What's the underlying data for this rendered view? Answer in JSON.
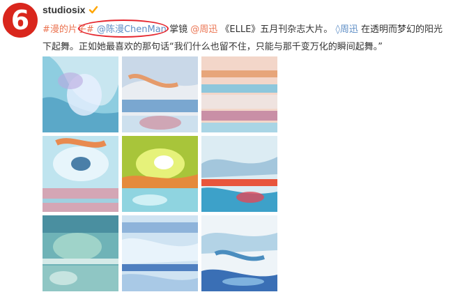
{
  "author": {
    "avatar_text": "6",
    "name": "studiosix"
  },
  "post": {
    "tag": "#漫的片子#",
    "mention_chenman": "@陈漫ChenMan",
    "text1": " 掌镜",
    "mention_zhouxun": "@周迅",
    "text2": " 《ELLE》五月刊杂志大片。",
    "zhouxun_link": "周迅",
    "text3": " 在透明而梦幻的阳光下起舞。正如她最喜欢的那句话“我们什么也留不住，只能与那千变万化的瞬间起舞。”"
  },
  "images": [
    "photo-1",
    "photo-2",
    "photo-3",
    "photo-4",
    "photo-5",
    "photo-6",
    "photo-7",
    "photo-8",
    "photo-9"
  ],
  "colors": {
    "avatar": "#d9261c",
    "mention": "#eb7350",
    "link": "#5d8dc5",
    "verified": "#ffa500"
  }
}
